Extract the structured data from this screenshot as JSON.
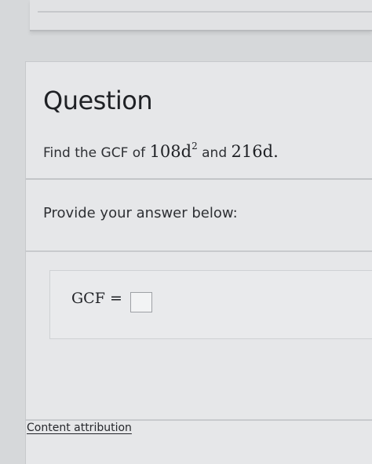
{
  "question": {
    "heading": "Question",
    "prompt_prefix": "Find the GCF of ",
    "term1_base": "108d",
    "term1_exponent": "2",
    "conjunction": " and ",
    "term2": "216d",
    "period": "."
  },
  "answer": {
    "instruction": "Provide your answer below:",
    "label": "GCF =",
    "value": ""
  },
  "footer": {
    "attribution_link": "Content attribution"
  }
}
